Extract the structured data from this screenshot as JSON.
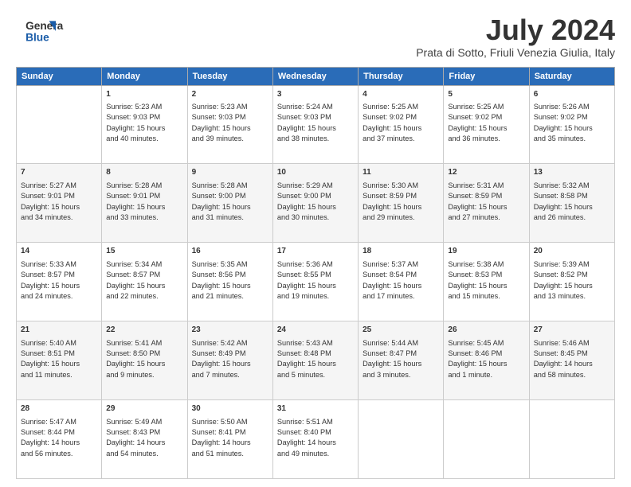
{
  "header": {
    "logo_line1": "General",
    "logo_line2": "Blue",
    "title": "July 2024",
    "subtitle": "Prata di Sotto, Friuli Venezia Giulia, Italy"
  },
  "columns": [
    "Sunday",
    "Monday",
    "Tuesday",
    "Wednesday",
    "Thursday",
    "Friday",
    "Saturday"
  ],
  "weeks": [
    [
      {
        "day": "",
        "info": ""
      },
      {
        "day": "1",
        "info": "Sunrise: 5:23 AM\nSunset: 9:03 PM\nDaylight: 15 hours\nand 40 minutes."
      },
      {
        "day": "2",
        "info": "Sunrise: 5:23 AM\nSunset: 9:03 PM\nDaylight: 15 hours\nand 39 minutes."
      },
      {
        "day": "3",
        "info": "Sunrise: 5:24 AM\nSunset: 9:03 PM\nDaylight: 15 hours\nand 38 minutes."
      },
      {
        "day": "4",
        "info": "Sunrise: 5:25 AM\nSunset: 9:02 PM\nDaylight: 15 hours\nand 37 minutes."
      },
      {
        "day": "5",
        "info": "Sunrise: 5:25 AM\nSunset: 9:02 PM\nDaylight: 15 hours\nand 36 minutes."
      },
      {
        "day": "6",
        "info": "Sunrise: 5:26 AM\nSunset: 9:02 PM\nDaylight: 15 hours\nand 35 minutes."
      }
    ],
    [
      {
        "day": "7",
        "info": "Sunrise: 5:27 AM\nSunset: 9:01 PM\nDaylight: 15 hours\nand 34 minutes."
      },
      {
        "day": "8",
        "info": "Sunrise: 5:28 AM\nSunset: 9:01 PM\nDaylight: 15 hours\nand 33 minutes."
      },
      {
        "day": "9",
        "info": "Sunrise: 5:28 AM\nSunset: 9:00 PM\nDaylight: 15 hours\nand 31 minutes."
      },
      {
        "day": "10",
        "info": "Sunrise: 5:29 AM\nSunset: 9:00 PM\nDaylight: 15 hours\nand 30 minutes."
      },
      {
        "day": "11",
        "info": "Sunrise: 5:30 AM\nSunset: 8:59 PM\nDaylight: 15 hours\nand 29 minutes."
      },
      {
        "day": "12",
        "info": "Sunrise: 5:31 AM\nSunset: 8:59 PM\nDaylight: 15 hours\nand 27 minutes."
      },
      {
        "day": "13",
        "info": "Sunrise: 5:32 AM\nSunset: 8:58 PM\nDaylight: 15 hours\nand 26 minutes."
      }
    ],
    [
      {
        "day": "14",
        "info": "Sunrise: 5:33 AM\nSunset: 8:57 PM\nDaylight: 15 hours\nand 24 minutes."
      },
      {
        "day": "15",
        "info": "Sunrise: 5:34 AM\nSunset: 8:57 PM\nDaylight: 15 hours\nand 22 minutes."
      },
      {
        "day": "16",
        "info": "Sunrise: 5:35 AM\nSunset: 8:56 PM\nDaylight: 15 hours\nand 21 minutes."
      },
      {
        "day": "17",
        "info": "Sunrise: 5:36 AM\nSunset: 8:55 PM\nDaylight: 15 hours\nand 19 minutes."
      },
      {
        "day": "18",
        "info": "Sunrise: 5:37 AM\nSunset: 8:54 PM\nDaylight: 15 hours\nand 17 minutes."
      },
      {
        "day": "19",
        "info": "Sunrise: 5:38 AM\nSunset: 8:53 PM\nDaylight: 15 hours\nand 15 minutes."
      },
      {
        "day": "20",
        "info": "Sunrise: 5:39 AM\nSunset: 8:52 PM\nDaylight: 15 hours\nand 13 minutes."
      }
    ],
    [
      {
        "day": "21",
        "info": "Sunrise: 5:40 AM\nSunset: 8:51 PM\nDaylight: 15 hours\nand 11 minutes."
      },
      {
        "day": "22",
        "info": "Sunrise: 5:41 AM\nSunset: 8:50 PM\nDaylight: 15 hours\nand 9 minutes."
      },
      {
        "day": "23",
        "info": "Sunrise: 5:42 AM\nSunset: 8:49 PM\nDaylight: 15 hours\nand 7 minutes."
      },
      {
        "day": "24",
        "info": "Sunrise: 5:43 AM\nSunset: 8:48 PM\nDaylight: 15 hours\nand 5 minutes."
      },
      {
        "day": "25",
        "info": "Sunrise: 5:44 AM\nSunset: 8:47 PM\nDaylight: 15 hours\nand 3 minutes."
      },
      {
        "day": "26",
        "info": "Sunrise: 5:45 AM\nSunset: 8:46 PM\nDaylight: 15 hours\nand 1 minute."
      },
      {
        "day": "27",
        "info": "Sunrise: 5:46 AM\nSunset: 8:45 PM\nDaylight: 14 hours\nand 58 minutes."
      }
    ],
    [
      {
        "day": "28",
        "info": "Sunrise: 5:47 AM\nSunset: 8:44 PM\nDaylight: 14 hours\nand 56 minutes."
      },
      {
        "day": "29",
        "info": "Sunrise: 5:49 AM\nSunset: 8:43 PM\nDaylight: 14 hours\nand 54 minutes."
      },
      {
        "day": "30",
        "info": "Sunrise: 5:50 AM\nSunset: 8:41 PM\nDaylight: 14 hours\nand 51 minutes."
      },
      {
        "day": "31",
        "info": "Sunrise: 5:51 AM\nSunset: 8:40 PM\nDaylight: 14 hours\nand 49 minutes."
      },
      {
        "day": "",
        "info": ""
      },
      {
        "day": "",
        "info": ""
      },
      {
        "day": "",
        "info": ""
      }
    ]
  ]
}
